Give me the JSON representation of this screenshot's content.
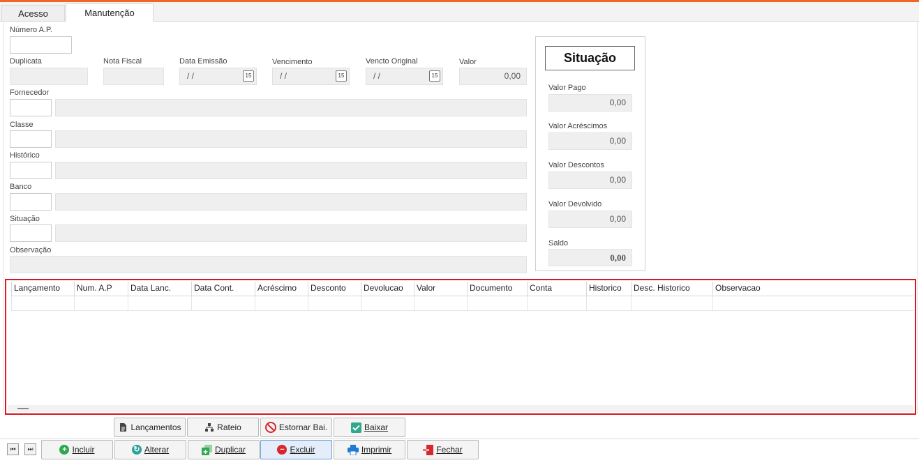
{
  "tabs": [
    "Acesso",
    "Manutenção"
  ],
  "form": {
    "numero_ap": {
      "label": "Número A.P.",
      "value": ""
    },
    "duplicata": {
      "label": "Duplicata",
      "value": ""
    },
    "nota_fiscal": {
      "label": "Nota Fiscal",
      "value": ""
    },
    "data_emissao": {
      "label": "Data Emissão",
      "value": "/  /"
    },
    "vencimento": {
      "label": "Vencimento",
      "value": "/  /"
    },
    "vencto_original": {
      "label": "Vencto Original",
      "value": "/  /"
    },
    "valor": {
      "label": "Valor",
      "value": "0,00"
    },
    "fornecedor": {
      "label": "Fornecedor"
    },
    "classe": {
      "label": "Classe"
    },
    "historico": {
      "label": "Histórico"
    },
    "banco": {
      "label": "Banco"
    },
    "situacao": {
      "label": "Situação"
    },
    "observacao": {
      "label": "Observação"
    },
    "calendar_icon_text": "15"
  },
  "situacao_panel": {
    "title": "Situação",
    "valor_pago": {
      "label": "Valor Pago",
      "value": "0,00"
    },
    "valor_acrescimos": {
      "label": "Valor Acréscimos",
      "value": "0,00"
    },
    "valor_descontos": {
      "label": "Valor Descontos",
      "value": "0,00"
    },
    "valor_devolvido": {
      "label": "Valor Devolvido",
      "value": "0,00"
    },
    "saldo": {
      "label": "Saldo",
      "value": "0,00"
    }
  },
  "grid": {
    "columns": [
      "Lançamento",
      "Num. A.P",
      "Data Lanc.",
      "Data Cont.",
      "Acréscimo",
      "Desconto",
      "Devolucao",
      "Valor",
      "Documento",
      "Conta",
      "Historico",
      "Desc. Historico",
      "Observacao"
    ]
  },
  "actions_top": [
    {
      "label": "Lançamentos",
      "icon": "document-icon"
    },
    {
      "label": "Rateio",
      "icon": "hierarchy-icon"
    },
    {
      "label": "Estornar Bai.",
      "icon": "cancel-icon"
    },
    {
      "label": "Baixar",
      "icon": "checkmark-icon"
    }
  ],
  "actions_bottom": [
    {
      "label": "Incluir",
      "icon": "plus-circle-icon"
    },
    {
      "label": "Alterar",
      "icon": "refresh-icon"
    },
    {
      "label": "Duplicar",
      "icon": "duplicate-icon"
    },
    {
      "label": "Excluir",
      "icon": "minus-circle-icon"
    },
    {
      "label": "Imprimir",
      "icon": "printer-icon"
    },
    {
      "label": "Fechar",
      "icon": "exit-icon"
    }
  ],
  "colors": {
    "accent_top": "#f26522",
    "grid_border": "#d71920",
    "green": "#2fa84f",
    "blue": "#1f7bd1",
    "red": "#d9272e"
  }
}
